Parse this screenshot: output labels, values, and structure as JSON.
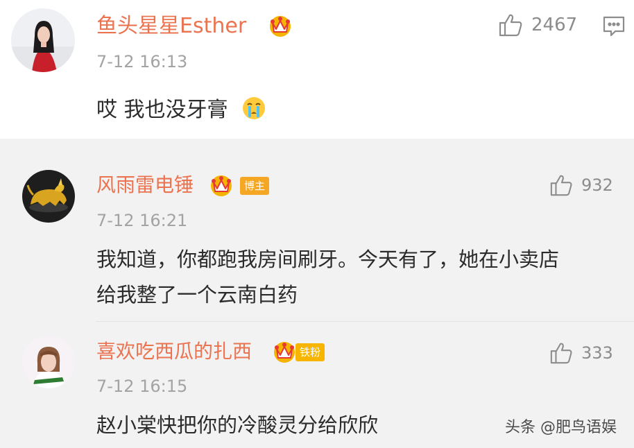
{
  "main_comment": {
    "username": "鱼头星星Esther",
    "timestamp": "7-12 16:13",
    "text": "哎 我也没牙膏",
    "emoji": "crying-face",
    "likes": "2467",
    "icons": [
      "vip-crown-icon",
      "like-icon",
      "comment-icon"
    ]
  },
  "replies": [
    {
      "username": "风雨雷电锤",
      "badge": "博主",
      "badge_color": "#f5a623",
      "timestamp": "7-12 16:21",
      "text_line1": "我知道，你都跑我房间刷牙。今天有了，她在小卖店",
      "text_line2": "给我整了一个云南白药",
      "likes": "932"
    },
    {
      "username": "喜欢吃西瓜的扎西",
      "badge": "铁粉",
      "badge_color": "#f7b500",
      "timestamp": "7-12 16:15",
      "text": "赵小棠快把你的冷酸灵分给欣欣",
      "likes": "333"
    }
  ],
  "watermark": "头条 @肥鸟语娱",
  "colors": {
    "username": "#eb7350",
    "timestamp": "#a3a3a3",
    "reply_background": "#f2f2f2",
    "crown": "#f4b400"
  }
}
